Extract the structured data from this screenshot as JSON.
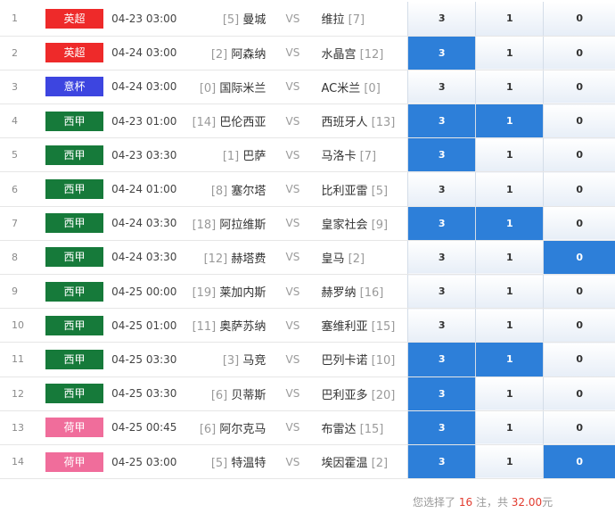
{
  "summary": {
    "prefix": "您选择了",
    "count": "16",
    "middle": "注，共",
    "amount": "32.00",
    "suffix": "元"
  },
  "colors": {
    "epl": "#ee2a2a",
    "efl_cup": "#3d45e0",
    "laliga": "#167a3a",
    "eredivisie": "#f06d9b",
    "selected": "#2d7fd9"
  },
  "matches": [
    {
      "no": "1",
      "league": "英超",
      "league_color": "#ee2a2a",
      "time": "04-23 03:00",
      "home_rank": "[5]",
      "home": "曼城",
      "vs": "VS",
      "away": "维拉",
      "away_rank": "[7]",
      "opt3": "3",
      "opt1": "1",
      "opt0": "0",
      "sel3": false,
      "sel1": false,
      "sel0": false
    },
    {
      "no": "2",
      "league": "英超",
      "league_color": "#ee2a2a",
      "time": "04-24 03:00",
      "home_rank": "[2]",
      "home": "阿森纳",
      "vs": "VS",
      "away": "水晶宫",
      "away_rank": "[12]",
      "opt3": "3",
      "opt1": "1",
      "opt0": "0",
      "sel3": true,
      "sel1": false,
      "sel0": false
    },
    {
      "no": "3",
      "league": "意杯",
      "league_color": "#3d45e0",
      "time": "04-24 03:00",
      "home_rank": "[0]",
      "home": "国际米兰",
      "vs": "VS",
      "away": "AC米兰",
      "away_rank": "[0]",
      "opt3": "3",
      "opt1": "1",
      "opt0": "0",
      "sel3": false,
      "sel1": false,
      "sel0": false
    },
    {
      "no": "4",
      "league": "西甲",
      "league_color": "#167a3a",
      "time": "04-23 01:00",
      "home_rank": "[14]",
      "home": "巴伦西亚",
      "vs": "VS",
      "away": "西班牙人",
      "away_rank": "[13]",
      "opt3": "3",
      "opt1": "1",
      "opt0": "0",
      "sel3": true,
      "sel1": true,
      "sel0": false
    },
    {
      "no": "5",
      "league": "西甲",
      "league_color": "#167a3a",
      "time": "04-23 03:30",
      "home_rank": "[1]",
      "home": "巴萨",
      "vs": "VS",
      "away": "马洛卡",
      "away_rank": "[7]",
      "opt3": "3",
      "opt1": "1",
      "opt0": "0",
      "sel3": true,
      "sel1": false,
      "sel0": false
    },
    {
      "no": "6",
      "league": "西甲",
      "league_color": "#167a3a",
      "time": "04-24 01:00",
      "home_rank": "[8]",
      "home": "塞尔塔",
      "vs": "VS",
      "away": "比利亚雷",
      "away_rank": "[5]",
      "opt3": "3",
      "opt1": "1",
      "opt0": "0",
      "sel3": false,
      "sel1": false,
      "sel0": false
    },
    {
      "no": "7",
      "league": "西甲",
      "league_color": "#167a3a",
      "time": "04-24 03:30",
      "home_rank": "[18]",
      "home": "阿拉维斯",
      "vs": "VS",
      "away": "皇家社会",
      "away_rank": "[9]",
      "opt3": "3",
      "opt1": "1",
      "opt0": "0",
      "sel3": true,
      "sel1": true,
      "sel0": false
    },
    {
      "no": "8",
      "league": "西甲",
      "league_color": "#167a3a",
      "time": "04-24 03:30",
      "home_rank": "[12]",
      "home": "赫塔费",
      "vs": "VS",
      "away": "皇马",
      "away_rank": "[2]",
      "opt3": "3",
      "opt1": "1",
      "opt0": "0",
      "sel3": false,
      "sel1": false,
      "sel0": true
    },
    {
      "no": "9",
      "league": "西甲",
      "league_color": "#167a3a",
      "time": "04-25 00:00",
      "home_rank": "[19]",
      "home": "莱加内斯",
      "vs": "VS",
      "away": "赫罗纳",
      "away_rank": "[16]",
      "opt3": "3",
      "opt1": "1",
      "opt0": "0",
      "sel3": false,
      "sel1": false,
      "sel0": false
    },
    {
      "no": "10",
      "league": "西甲",
      "league_color": "#167a3a",
      "time": "04-25 01:00",
      "home_rank": "[11]",
      "home": "奥萨苏纳",
      "vs": "VS",
      "away": "塞维利亚",
      "away_rank": "[15]",
      "opt3": "3",
      "opt1": "1",
      "opt0": "0",
      "sel3": false,
      "sel1": false,
      "sel0": false
    },
    {
      "no": "11",
      "league": "西甲",
      "league_color": "#167a3a",
      "time": "04-25 03:30",
      "home_rank": "[3]",
      "home": "马竞",
      "vs": "VS",
      "away": "巴列卡诺",
      "away_rank": "[10]",
      "opt3": "3",
      "opt1": "1",
      "opt0": "0",
      "sel3": true,
      "sel1": true,
      "sel0": false
    },
    {
      "no": "12",
      "league": "西甲",
      "league_color": "#167a3a",
      "time": "04-25 03:30",
      "home_rank": "[6]",
      "home": "贝蒂斯",
      "vs": "VS",
      "away": "巴利亚多",
      "away_rank": "[20]",
      "opt3": "3",
      "opt1": "1",
      "opt0": "0",
      "sel3": true,
      "sel1": false,
      "sel0": false
    },
    {
      "no": "13",
      "league": "荷甲",
      "league_color": "#f06d9b",
      "time": "04-25 00:45",
      "home_rank": "[6]",
      "home": "阿尔克马",
      "vs": "VS",
      "away": "布雷达",
      "away_rank": "[15]",
      "opt3": "3",
      "opt1": "1",
      "opt0": "0",
      "sel3": true,
      "sel1": false,
      "sel0": false
    },
    {
      "no": "14",
      "league": "荷甲",
      "league_color": "#f06d9b",
      "time": "04-25 03:00",
      "home_rank": "[5]",
      "home": "特温特",
      "vs": "VS",
      "away": "埃因霍温",
      "away_rank": "[2]",
      "opt3": "3",
      "opt1": "1",
      "opt0": "0",
      "sel3": true,
      "sel1": false,
      "sel0": true
    }
  ]
}
